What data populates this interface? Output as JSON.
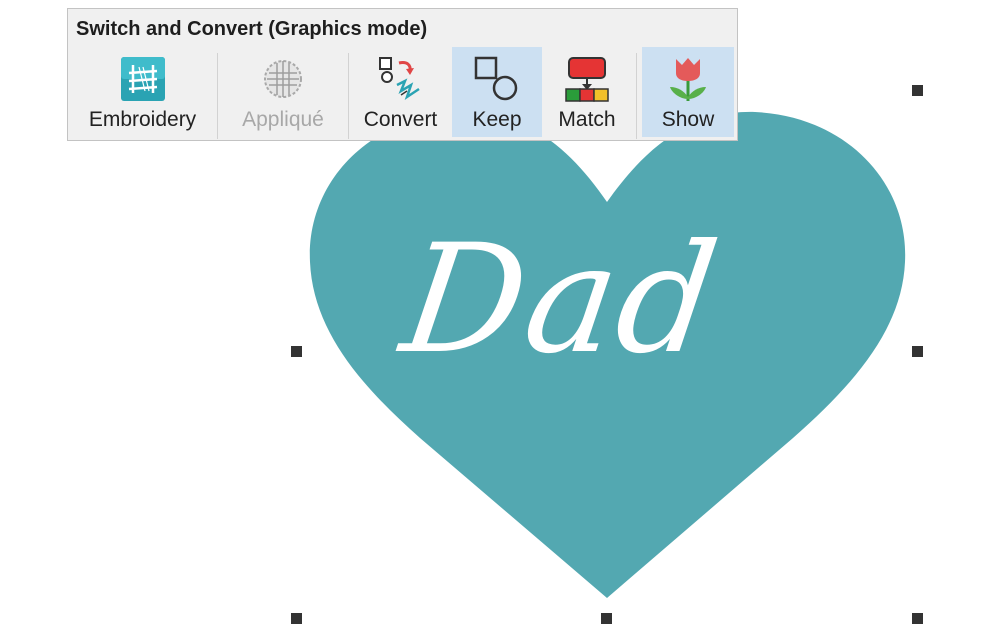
{
  "toolbar": {
    "title": "Switch and Convert (Graphics mode)",
    "buttons": [
      {
        "label": "Embroidery",
        "icon": "embroidery-icon",
        "state": "normal"
      },
      {
        "label": "Appliqué",
        "icon": "applique-icon",
        "state": "disabled"
      },
      {
        "label": "Convert",
        "icon": "convert-icon",
        "state": "normal"
      },
      {
        "label": "Keep",
        "icon": "keep-shapes-icon",
        "state": "active"
      },
      {
        "label": "Match",
        "icon": "match-colors-icon",
        "state": "normal"
      },
      {
        "label": "Show",
        "icon": "show-flower-icon",
        "state": "active"
      }
    ]
  },
  "design": {
    "text": "Dad",
    "heart_color": "#53a8b1",
    "text_color": "#ffffff"
  },
  "colors": {
    "toolbar_bg": "#f0f0f0",
    "active_bg": "#cce0f2",
    "handle": "#333333"
  }
}
